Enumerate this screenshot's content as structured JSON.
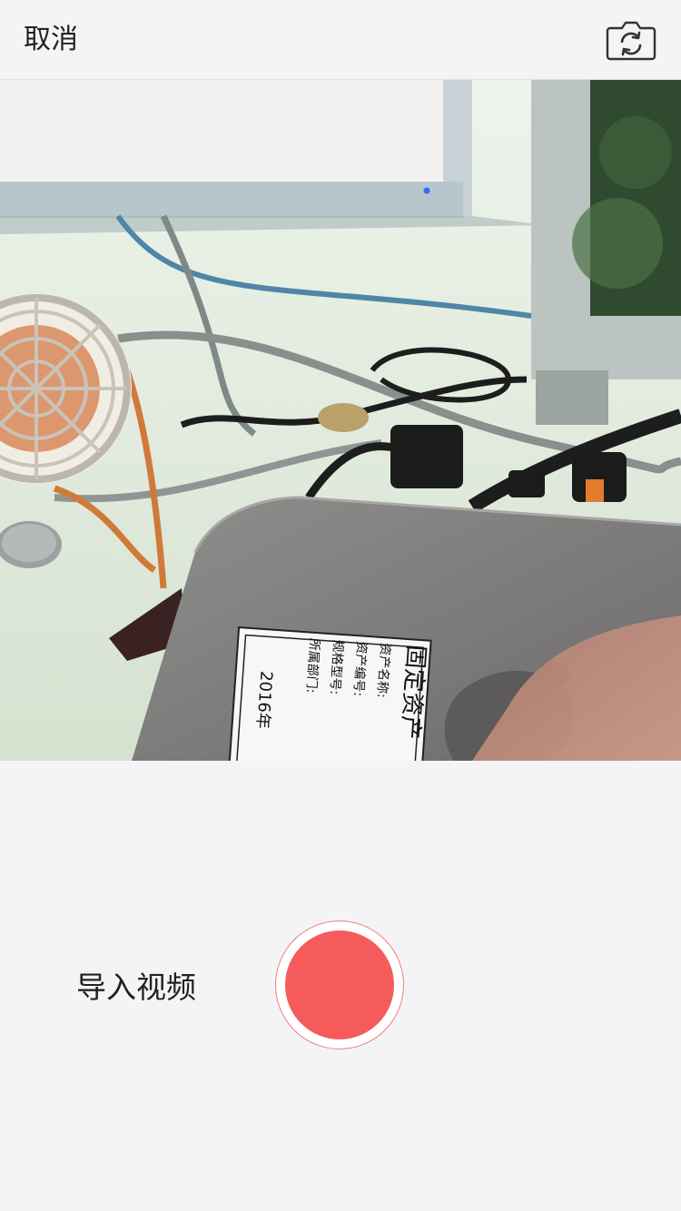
{
  "header": {
    "cancel_label": "取消",
    "switch_camera_icon": "camera-switch-icon"
  },
  "preview": {
    "label_sticker": {
      "title": "固定资产",
      "row1": "资产名称:",
      "row2": "资产编号:",
      "row3": "规格型号:",
      "row4": "所属部门:",
      "year": "2016年"
    }
  },
  "controls": {
    "import_video_label": "导入视频",
    "record_icon": "record-button-icon",
    "record_color": "#f65b5b"
  }
}
